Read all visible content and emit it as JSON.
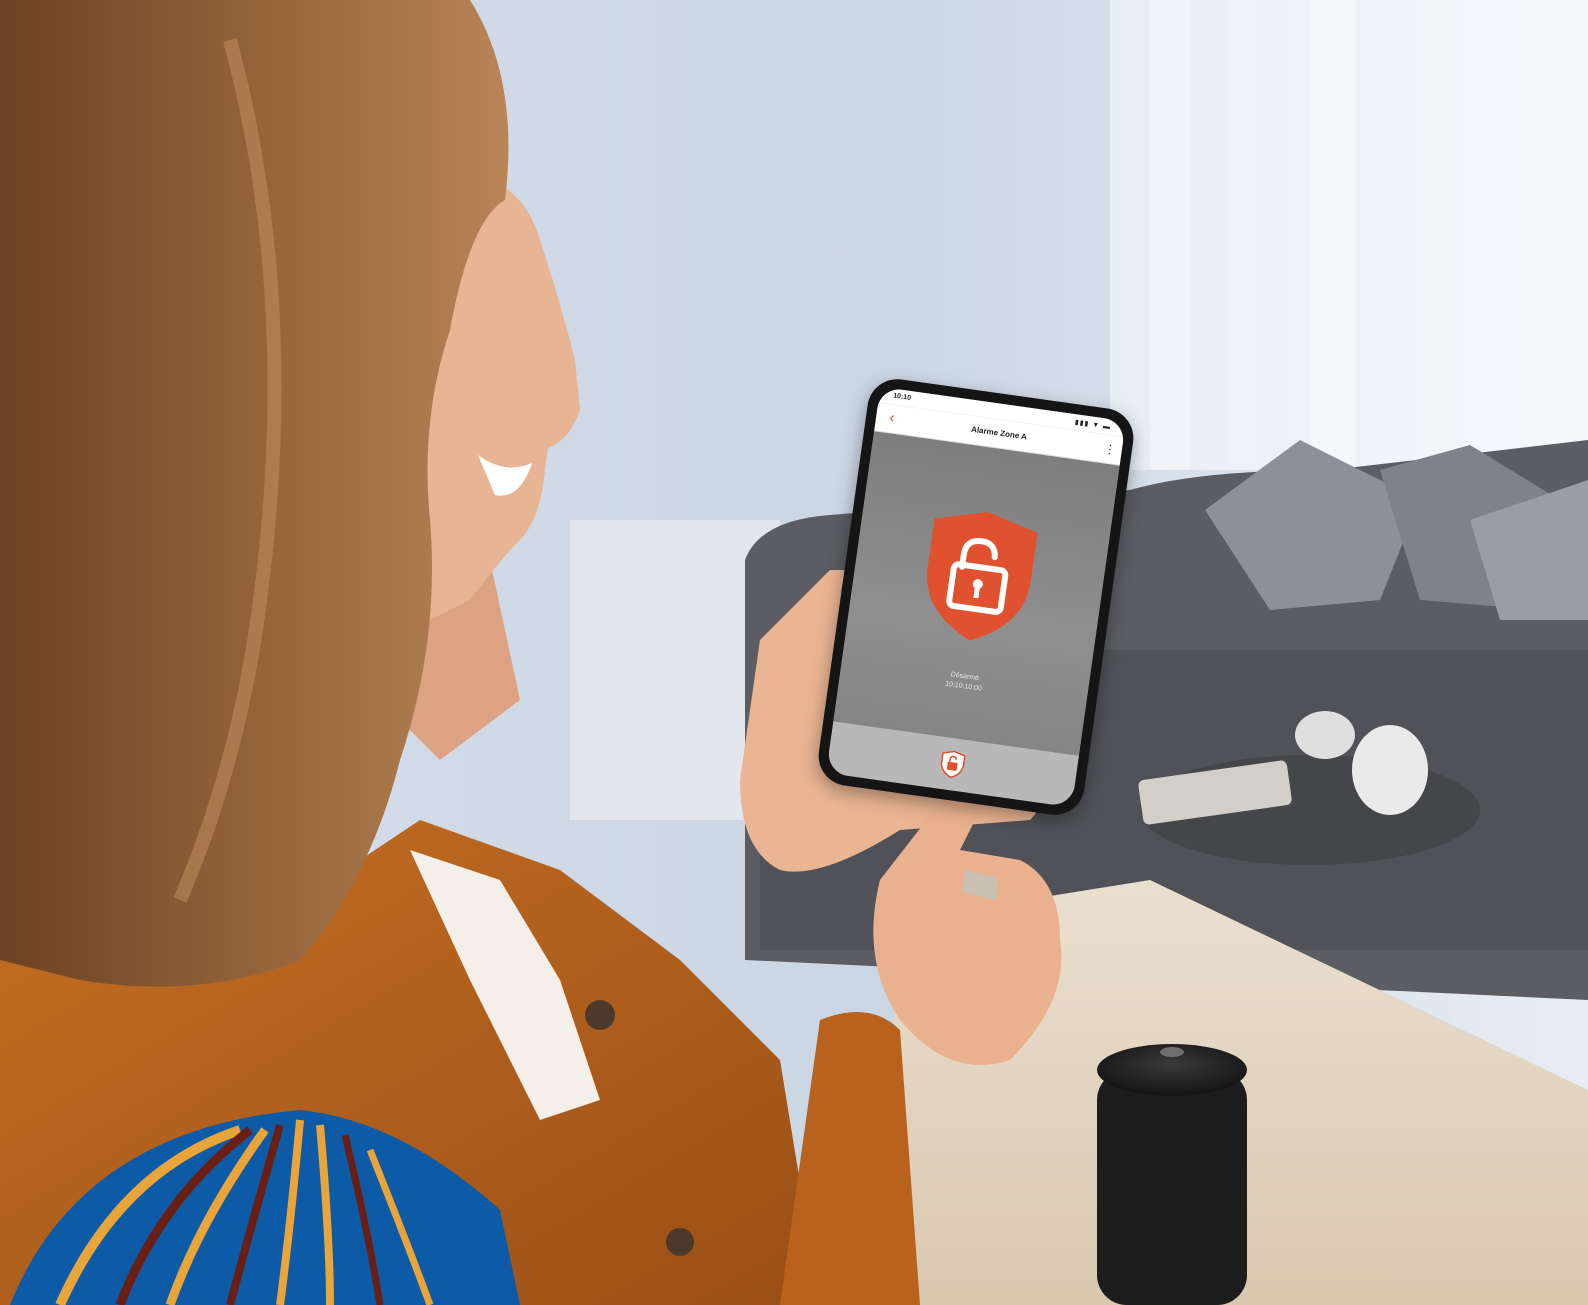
{
  "colors": {
    "accent_orange": "#e0522f",
    "logo_blue": "#0d5aa6",
    "logo_gold": "#e9a43a",
    "logo_maroon": "#6a1f14",
    "wall": "#cfd8e4",
    "sofa": "#5a5c61",
    "table": "#e8dccb",
    "shirt": "#b8621d",
    "hair": "#8a5a34",
    "skin": "#e7b08d"
  },
  "phone": {
    "status_bar": {
      "time": "10:10",
      "icons": "▮▮▮ ▼ ▬"
    },
    "app_bar": {
      "back_icon": "chevron-left-icon",
      "title": "Alarme Zone A",
      "menu_icon": "kebab-menu-icon"
    },
    "main": {
      "shield_icon": "shield-unlocked-padlock-icon",
      "status_line_1": "Désarmé",
      "status_line_2": "10:10:10:00"
    },
    "bottom_bar": {
      "toggle_icon": "small-shield-padlock-icon"
    }
  },
  "logo": {
    "icon": "blue-gold-arc-logo"
  }
}
